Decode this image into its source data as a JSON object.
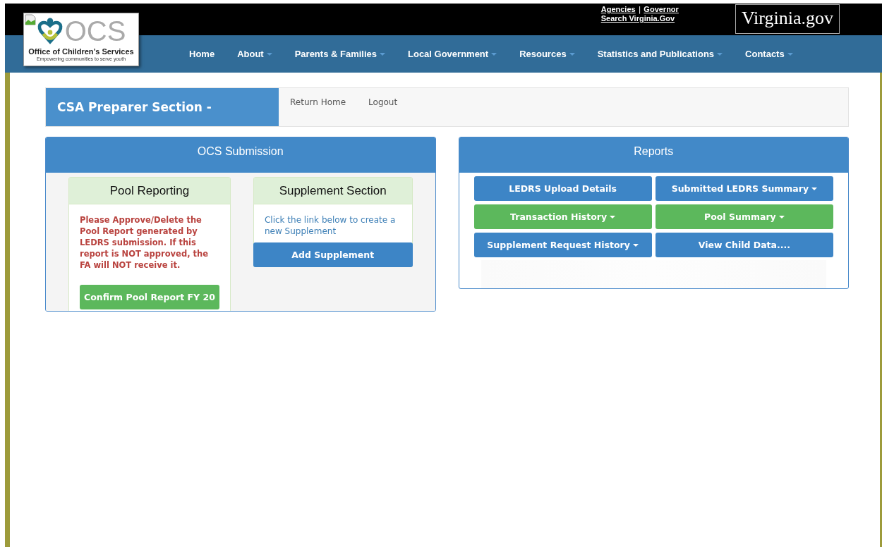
{
  "header": {
    "logo": {
      "mark": "OCS",
      "name": "Office of Children’s Services",
      "tagline": "Empowering communities to serve youth"
    },
    "top_links": [
      {
        "label": "Agencies"
      },
      {
        "label": "Governor"
      },
      {
        "label": "Search Virginia.Gov"
      }
    ],
    "link_separator": "|",
    "state_logo": "Virginia.gov"
  },
  "nav": [
    {
      "label": "Home",
      "dropdown": false
    },
    {
      "label": "About",
      "dropdown": true
    },
    {
      "label": "Parents & Families",
      "dropdown": true
    },
    {
      "label": "Local Government",
      "dropdown": true
    },
    {
      "label": "Resources",
      "dropdown": true
    },
    {
      "label": "Statistics and Publications",
      "dropdown": true
    },
    {
      "label": "Contacts",
      "dropdown": true
    }
  ],
  "section": {
    "title": "CSA Preparer Section -",
    "links": [
      "Return Home",
      "Logout"
    ]
  },
  "submission": {
    "title": "OCS Submission",
    "cards": [
      {
        "title": "Pool Reporting",
        "text": "Please Approve/Delete the Pool Report generated by LEDRS submission. If this report is NOT approved, the FA will NOT receive it.",
        "kind": "warning",
        "button": {
          "label": "Confirm Pool Report FY 20",
          "kind": "success"
        }
      },
      {
        "title": "Supplement Section",
        "text": "Click the link below to create a new Supplement",
        "kind": "info",
        "button": {
          "label": "Add Supplement",
          "kind": "primary"
        }
      }
    ]
  },
  "reports": {
    "title": "Reports",
    "buttons": [
      {
        "label": "LEDRS Upload Details",
        "kind": "primary",
        "dropdown": false
      },
      {
        "label": "Submitted LEDRS Summary",
        "kind": "primary",
        "dropdown": true
      },
      {
        "label": "Transaction History",
        "kind": "success",
        "dropdown": true
      },
      {
        "label": "Pool Summary",
        "kind": "success",
        "dropdown": true
      },
      {
        "label": "Supplement Request History",
        "kind": "primary",
        "dropdown": true
      },
      {
        "label": "View Child Data....",
        "kind": "primary",
        "dropdown": false
      }
    ]
  }
}
